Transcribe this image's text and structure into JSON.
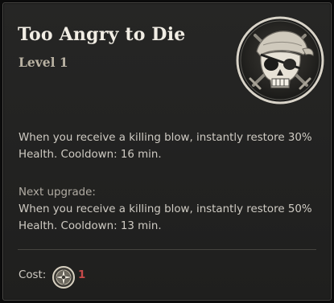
{
  "ability": {
    "title": "Too Angry to Die",
    "level": "Level 1",
    "icon": "pirate-skull-icon",
    "description_lines": [
      "When you receive a killing blow, instantly restore 30%",
      "Health. Cooldown: 16 min."
    ],
    "next_upgrade": {
      "label": "Next upgrade:",
      "lines": [
        "When you receive a killing blow, instantly restore 50%",
        "Health. Cooldown: 13 min."
      ]
    }
  },
  "cost": {
    "label": "Cost:",
    "icon": "compass-token-icon",
    "value": "1"
  },
  "colors": {
    "background": "#232322",
    "title": "#f1ede4",
    "text": "#cfcbc3",
    "cost_value": "#c74a4a"
  }
}
